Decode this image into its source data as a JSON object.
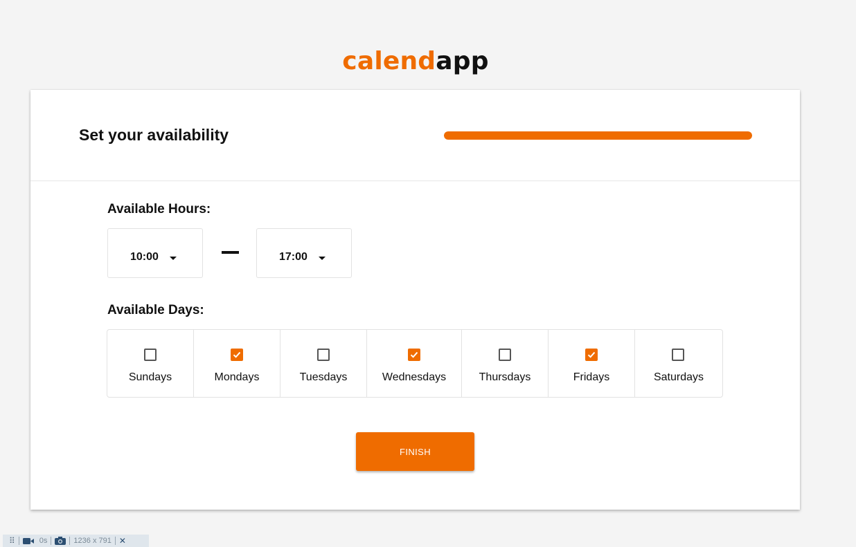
{
  "brand": {
    "part1": "calend",
    "part2": "app"
  },
  "header": {
    "title": "Set your availability",
    "progress": 1.0
  },
  "hours": {
    "label": "Available Hours:",
    "start": "10:00",
    "end": "17:00"
  },
  "days": {
    "label": "Available Days:",
    "items": [
      {
        "label": "Sundays",
        "checked": false
      },
      {
        "label": "Mondays",
        "checked": true
      },
      {
        "label": "Tuesdays",
        "checked": false
      },
      {
        "label": "Wednesdays",
        "checked": true
      },
      {
        "label": "Thursdays",
        "checked": false
      },
      {
        "label": "Fridays",
        "checked": true
      },
      {
        "label": "Saturdays",
        "checked": false
      }
    ]
  },
  "finish_label": "FINISH",
  "toolbar": {
    "time": "0s",
    "size": "1236 x 791"
  },
  "colors": {
    "accent": "#ef6c00"
  }
}
